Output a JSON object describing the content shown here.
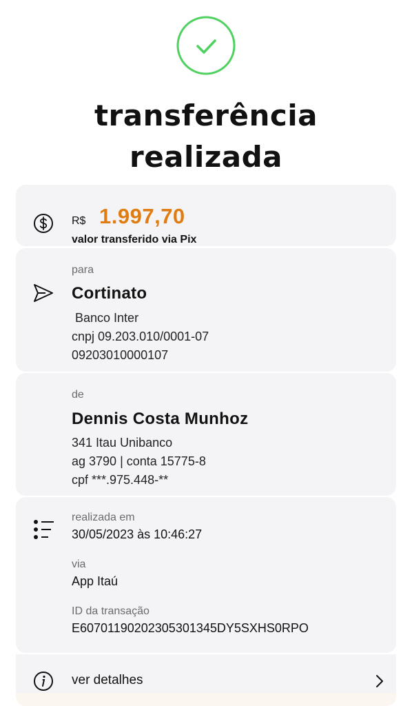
{
  "header": {
    "title_line1": "transferência",
    "title_line2": "realizada"
  },
  "amount": {
    "currency": "R$",
    "value": "1.997,70",
    "caption": "valor transferido via Pix",
    "accent": "#e07d12"
  },
  "recipient": {
    "label": "para",
    "name": "Cortinato",
    "bank": " Banco Inter",
    "doc": "cnpj 09.203.010/0001-07",
    "key": "09203010000107"
  },
  "sender": {
    "label": "de",
    "name": "Dennis Costa Munhoz",
    "bank": "341 Itau Unibanco",
    "account": "ag 3790 | conta 15775-8",
    "doc": "cpf ***.975.448-**"
  },
  "info": {
    "date_label": "realizada em",
    "date_value": "30/05/2023 às 10:46:27",
    "via_label": "via",
    "via_value": "App Itaú",
    "id_label": "ID da transação",
    "id_value": "E60701190202305301345DY5SXHS0RPO"
  },
  "details": {
    "label": "ver detalhes"
  },
  "icons": {
    "success": "check-circle-icon",
    "amount": "dollar-circle-icon",
    "send": "send-icon",
    "list": "list-icon",
    "info": "info-icon",
    "chevron": "chevron-right-icon"
  },
  "colors": {
    "success": "#4fd160",
    "card": "#f4f4f7"
  }
}
